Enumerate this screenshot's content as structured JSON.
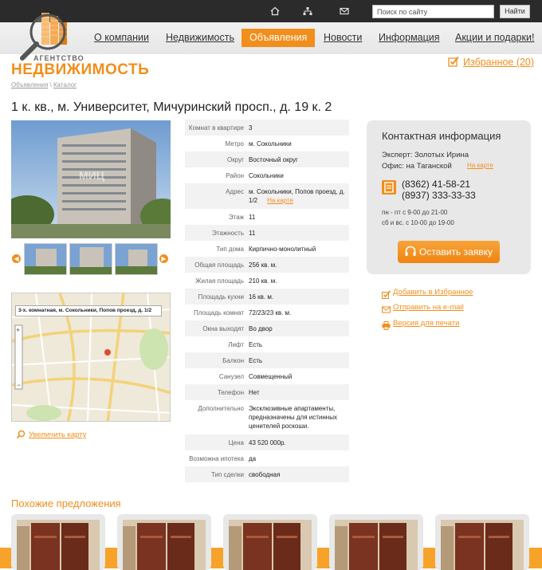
{
  "topbar": {
    "search_placeholder": "Поиск по сайту",
    "search_button": "Найти",
    "icons": [
      "home-icon",
      "sitemap-icon",
      "mail-icon"
    ]
  },
  "logo": {
    "small": "АГЕНТСТВО",
    "big": "НЕДВИЖИМОСТЬ"
  },
  "nav": {
    "items": [
      {
        "label": "О компании"
      },
      {
        "label": "Недвижимость"
      },
      {
        "label": "Объявления",
        "active": true
      },
      {
        "label": "Новости"
      },
      {
        "label": "Информация"
      },
      {
        "label": "Акции и подарки!"
      }
    ]
  },
  "favorites": {
    "label": "Избранное (20)"
  },
  "breadcrumb": {
    "items": [
      "Объявления",
      "Каталог"
    ],
    "separator": "\\"
  },
  "listing": {
    "title": "1 к. кв., м. Университет, Мичуринский просп., д. 19 к. 2",
    "map_label": "3-х. комнатная, м. Сокольники, Попов проезд, д. 1/2",
    "zoom_map": "Увеличить карту",
    "properties": [
      {
        "key": "Комнат в квартире",
        "value": "3"
      },
      {
        "key": "Метро",
        "value": "м. Сокольники"
      },
      {
        "key": "Округ",
        "value": "Восточный округ"
      },
      {
        "key": "Район",
        "value": "Сокольники"
      },
      {
        "key": "Адрес",
        "value": "м. Сокольники, Попов проезд, д. 1/2",
        "link": "На карте"
      },
      {
        "key": "Этаж",
        "value": "11"
      },
      {
        "key": "Этажность",
        "value": "11"
      },
      {
        "key": "Тип дома",
        "value": "Кирпично-монолитный"
      },
      {
        "key": "Общая площадь",
        "value": "256 кв. м."
      },
      {
        "key": "Жилая площадь",
        "value": "210 кв. м."
      },
      {
        "key": "Площадь кухни",
        "value": "16 кв. м."
      },
      {
        "key": "Площадь комнат",
        "value": "72/23/23 кв. м."
      },
      {
        "key": "Окна выходят",
        "value": "Во двор"
      },
      {
        "key": "Лифт",
        "value": "Есть"
      },
      {
        "key": "Балкон",
        "value": "Есть"
      },
      {
        "key": "Санузел",
        "value": "Совмещенный"
      },
      {
        "key": "Телефон",
        "value": "Нет"
      },
      {
        "key": "Дополнительно",
        "value": "Эксклюзивные апартаменты, предназначены для истинных ценителей роскоши."
      },
      {
        "key": "Цена",
        "value": "43 520 000р."
      },
      {
        "key": "Возможна ипотека",
        "value": "да"
      },
      {
        "key": "Тип сделки",
        "value": "свободная"
      }
    ]
  },
  "contact": {
    "title": "Контактная информация",
    "expert": "Эксперт: Золотых Ирина",
    "office": "Офис: на Таганской",
    "office_map": "На карте",
    "phone1": "(8362) 41-58-21",
    "phone2": "(8937) 333-33-33",
    "hours1": "пн - пт с 9-00 до 21-00",
    "hours2": "сб и вс. с 10-00 до 19-00",
    "apply_button": "Оставить заявку"
  },
  "actions": [
    {
      "label": "Добавить в Избранное",
      "icon": "favorite-icon"
    },
    {
      "label": "Отправить на e-mail",
      "icon": "mail-icon"
    },
    {
      "label": "Версия для печати",
      "icon": "print-icon"
    }
  ],
  "similar": {
    "title": "Похожие предложения"
  },
  "colors": {
    "accent": "#f18e1c",
    "dark": "#2b2b2b",
    "panel": "#e8e8e8"
  }
}
